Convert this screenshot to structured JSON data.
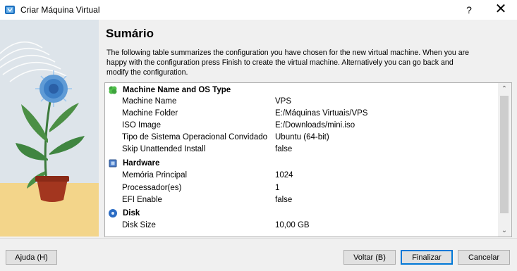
{
  "window": {
    "title": "Criar Máquina Virtual",
    "help_glyph": "?",
    "close_glyph": "✕"
  },
  "page": {
    "title": "Sumário",
    "description": "The following table summarizes the configuration you have chosen for the new virtual machine. When you are happy with the configuration press Finish to create the virtual machine. Alternatively you can go back and modify the configuration."
  },
  "summary": {
    "sections": [
      {
        "label": "Machine Name and OS Type",
        "icon": "os-type-icon",
        "items": [
          {
            "key": "Machine Name",
            "value": "VPS"
          },
          {
            "key": "Machine Folder",
            "value": "E:/Máquinas Virtuais/VPS"
          },
          {
            "key": "ISO Image",
            "value": "E:/Downloads/mini.iso"
          },
          {
            "key": "Tipo de Sistema Operacional Convidado",
            "value": "Ubuntu (64-bit)"
          },
          {
            "key": "Skip Unattended Install",
            "value": "false"
          }
        ]
      },
      {
        "label": "Hardware",
        "icon": "chip-icon",
        "items": [
          {
            "key": "Memória Principal",
            "value": "1024"
          },
          {
            "key": "Processador(es)",
            "value": "1"
          },
          {
            "key": "EFI Enable",
            "value": "false"
          }
        ]
      },
      {
        "label": "Disk",
        "icon": "disk-icon",
        "items": [
          {
            "key": "Disk Size",
            "value": "10,00 GB"
          }
        ]
      }
    ]
  },
  "scrollbar": {
    "up": "⌃",
    "down": "⌄"
  },
  "buttons": {
    "help": "Ajuda (H)",
    "back": "Voltar (B)",
    "finish": "Finalizar",
    "cancel": "Cancelar"
  },
  "colors": {
    "accent": "#0078d7",
    "os_icon": "#3ea33e",
    "hardware_icon": "#4a7cc9",
    "disk_icon": "#2b6cc4"
  }
}
